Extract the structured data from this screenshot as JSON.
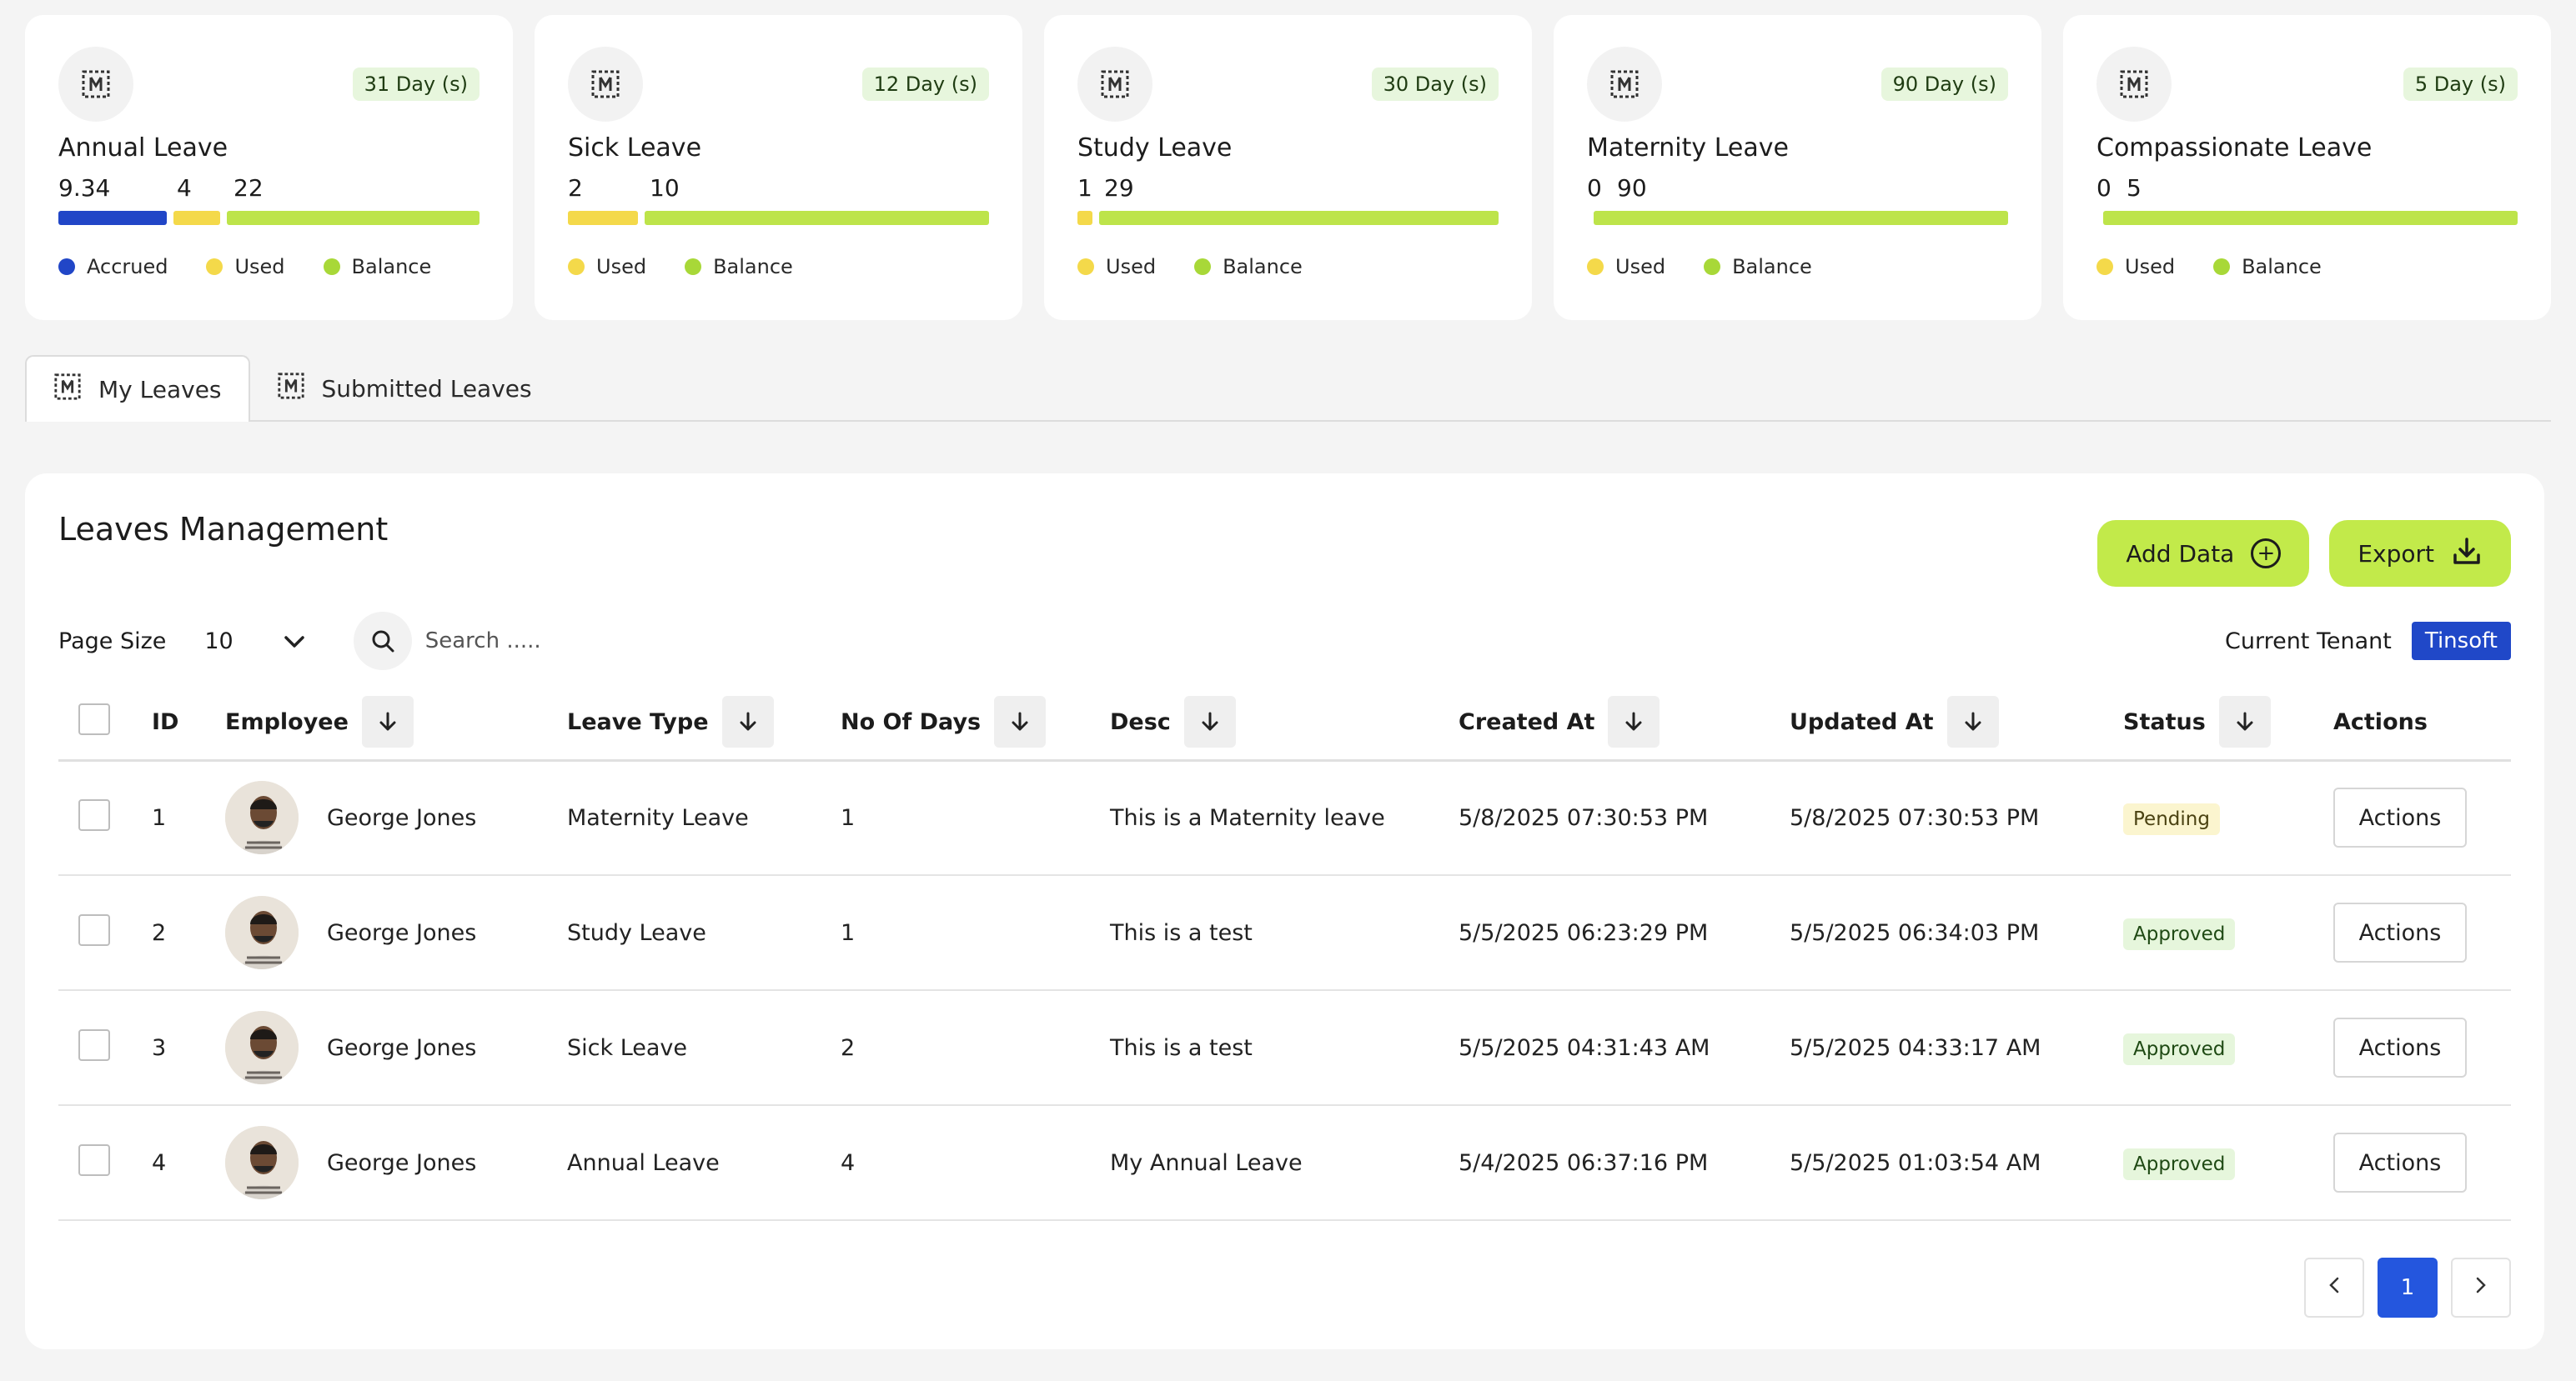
{
  "colors": {
    "accrued": "#2146c7",
    "used": "#f4d94a",
    "balance": "#bde44a",
    "accent_green": "#c2ea4a",
    "tenant_blue": "#2048c8",
    "page_blue": "#2456de"
  },
  "leave_cards": [
    {
      "title": "Annual Leave",
      "days": "31 Day (s)",
      "accrued": "9.34",
      "used": "4",
      "balance": "22",
      "icon": "leave-icon"
    },
    {
      "title": "Sick Leave",
      "days": "12 Day (s)",
      "used": "2",
      "balance": "10",
      "icon": "leave-icon"
    },
    {
      "title": "Study Leave",
      "days": "30 Day (s)",
      "used": "1",
      "balance": "29",
      "icon": "leave-icon"
    },
    {
      "title": "Maternity Leave",
      "days": "90 Day (s)",
      "used": "0",
      "balance": "90",
      "icon": "leave-icon"
    },
    {
      "title": "Compassionate Leave",
      "days": "5 Day (s)",
      "used": "0",
      "balance": "5",
      "icon": "leave-icon"
    }
  ],
  "legend": {
    "accrued": "Accrued",
    "used": "Used",
    "balance": "Balance"
  },
  "tabs": [
    {
      "label": "My Leaves",
      "active": true
    },
    {
      "label": "Submitted Leaves",
      "active": false
    }
  ],
  "panel": {
    "title": "Leaves Management",
    "add_button": "Add Data",
    "export_button": "Export",
    "page_size_label": "Page Size",
    "page_size_value": "10",
    "search_placeholder": "Search .....",
    "tenant_label": "Current Tenant",
    "tenant_value": "Tinsoft"
  },
  "table": {
    "columns": [
      "ID",
      "Employee",
      "Leave Type",
      "No Of Days",
      "Desc",
      "Created At",
      "Updated At",
      "Status",
      "Actions"
    ],
    "rows": [
      {
        "id": "1",
        "employee": "George Jones",
        "leave_type": "Maternity Leave",
        "days": "1",
        "desc": "This is a Maternity leave",
        "created": "5/8/2025 07:30:53 PM",
        "updated": "5/8/2025 07:30:53 PM",
        "status": "Pending",
        "action": "Actions"
      },
      {
        "id": "2",
        "employee": "George Jones",
        "leave_type": "Study Leave",
        "days": "1",
        "desc": "This is a test",
        "created": "5/5/2025 06:23:29 PM",
        "updated": "5/5/2025 06:34:03 PM",
        "status": "Approved",
        "action": "Actions"
      },
      {
        "id": "3",
        "employee": "George Jones",
        "leave_type": "Sick Leave",
        "days": "2",
        "desc": "This is a test",
        "created": "5/5/2025 04:31:43 AM",
        "updated": "5/5/2025 04:33:17 AM",
        "status": "Approved",
        "action": "Actions"
      },
      {
        "id": "4",
        "employee": "George Jones",
        "leave_type": "Annual Leave",
        "days": "4",
        "desc": "My Annual Leave",
        "created": "5/4/2025 06:37:16 PM",
        "updated": "5/5/2025 01:03:54 AM",
        "status": "Approved",
        "action": "Actions"
      }
    ]
  },
  "pagination": {
    "current": "1"
  }
}
